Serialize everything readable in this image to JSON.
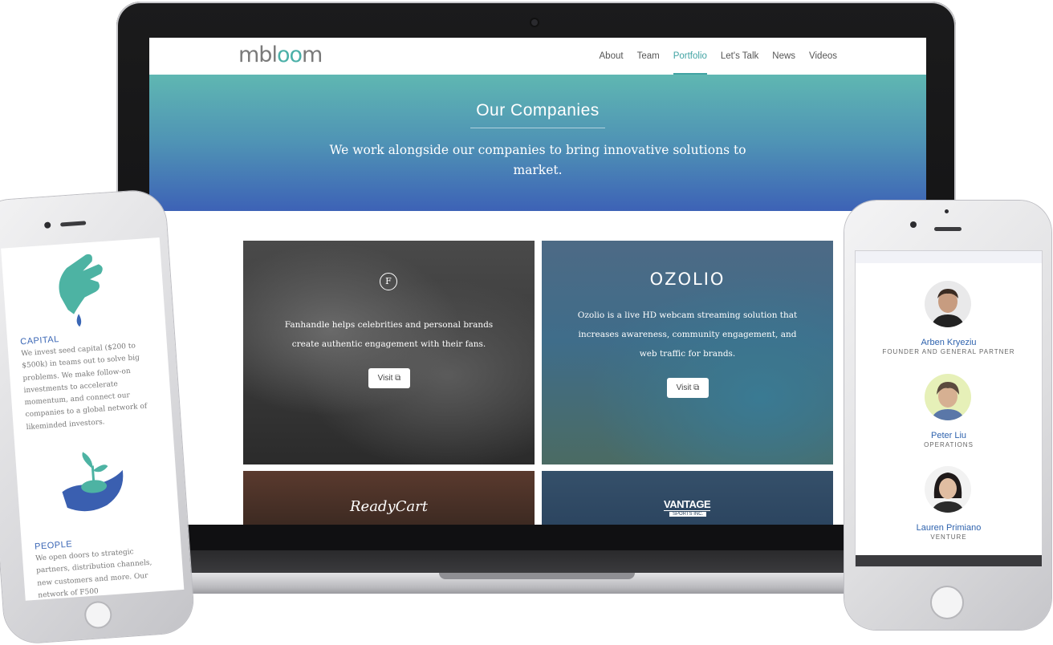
{
  "site": {
    "logo": {
      "pre": "mbl",
      "accent": "oo",
      "post": "m"
    },
    "nav": [
      "About",
      "Team",
      "Portfolio",
      "Let's Talk",
      "News",
      "Videos"
    ],
    "active_nav": "Portfolio",
    "hero": {
      "title": "Our Companies",
      "subtitle": "We work alongside our companies to bring innovative solutions to market."
    },
    "companies": [
      {
        "name": "Fanhandle",
        "logo": "F",
        "text": "Fanhandle helps celebrities and personal brands create authentic engagement with their fans.",
        "button": "Visit"
      },
      {
        "name": "Ozolio",
        "logo": "OZOLIO",
        "text": "Ozolio is a live HD webcam streaming solution that increases awareness, community engagement, and web traffic for brands.",
        "button": "Visit"
      },
      {
        "name": "ReadyCart",
        "logo": "ReadyCart"
      },
      {
        "name": "Vantage Sports",
        "logo": "VANTAGE",
        "logo_sub": "SPORTS INC."
      }
    ]
  },
  "mobile_left": {
    "sections": [
      {
        "heading": "CAPITAL",
        "text": "We invest seed capital ($200 to $500k) in teams out to solve big problems. We make follow-on investments to accelerate momentum, and connect our companies to a global network of likeminded investors."
      },
      {
        "heading": "PEOPLE",
        "text": "We open doors to strategic partners, distribution channels, new customers and more. Our network of F500"
      }
    ]
  },
  "mobile_right": {
    "team": [
      {
        "name": "Arben Kryeziu",
        "role": "FOUNDER AND GENERAL PARTNER"
      },
      {
        "name": "Peter Liu",
        "role": "OPERATIONS"
      },
      {
        "name": "Lauren Primiano",
        "role": "VENTURE"
      }
    ]
  },
  "colors": {
    "accent": "#41a3a3",
    "hero_top": "#5fb7b2",
    "hero_bottom": "#3d62b6",
    "link_blue": "#2f63ae"
  },
  "icons": [
    "external-link-icon",
    "camera-icon",
    "speaker-icon",
    "home-button-icon"
  ]
}
